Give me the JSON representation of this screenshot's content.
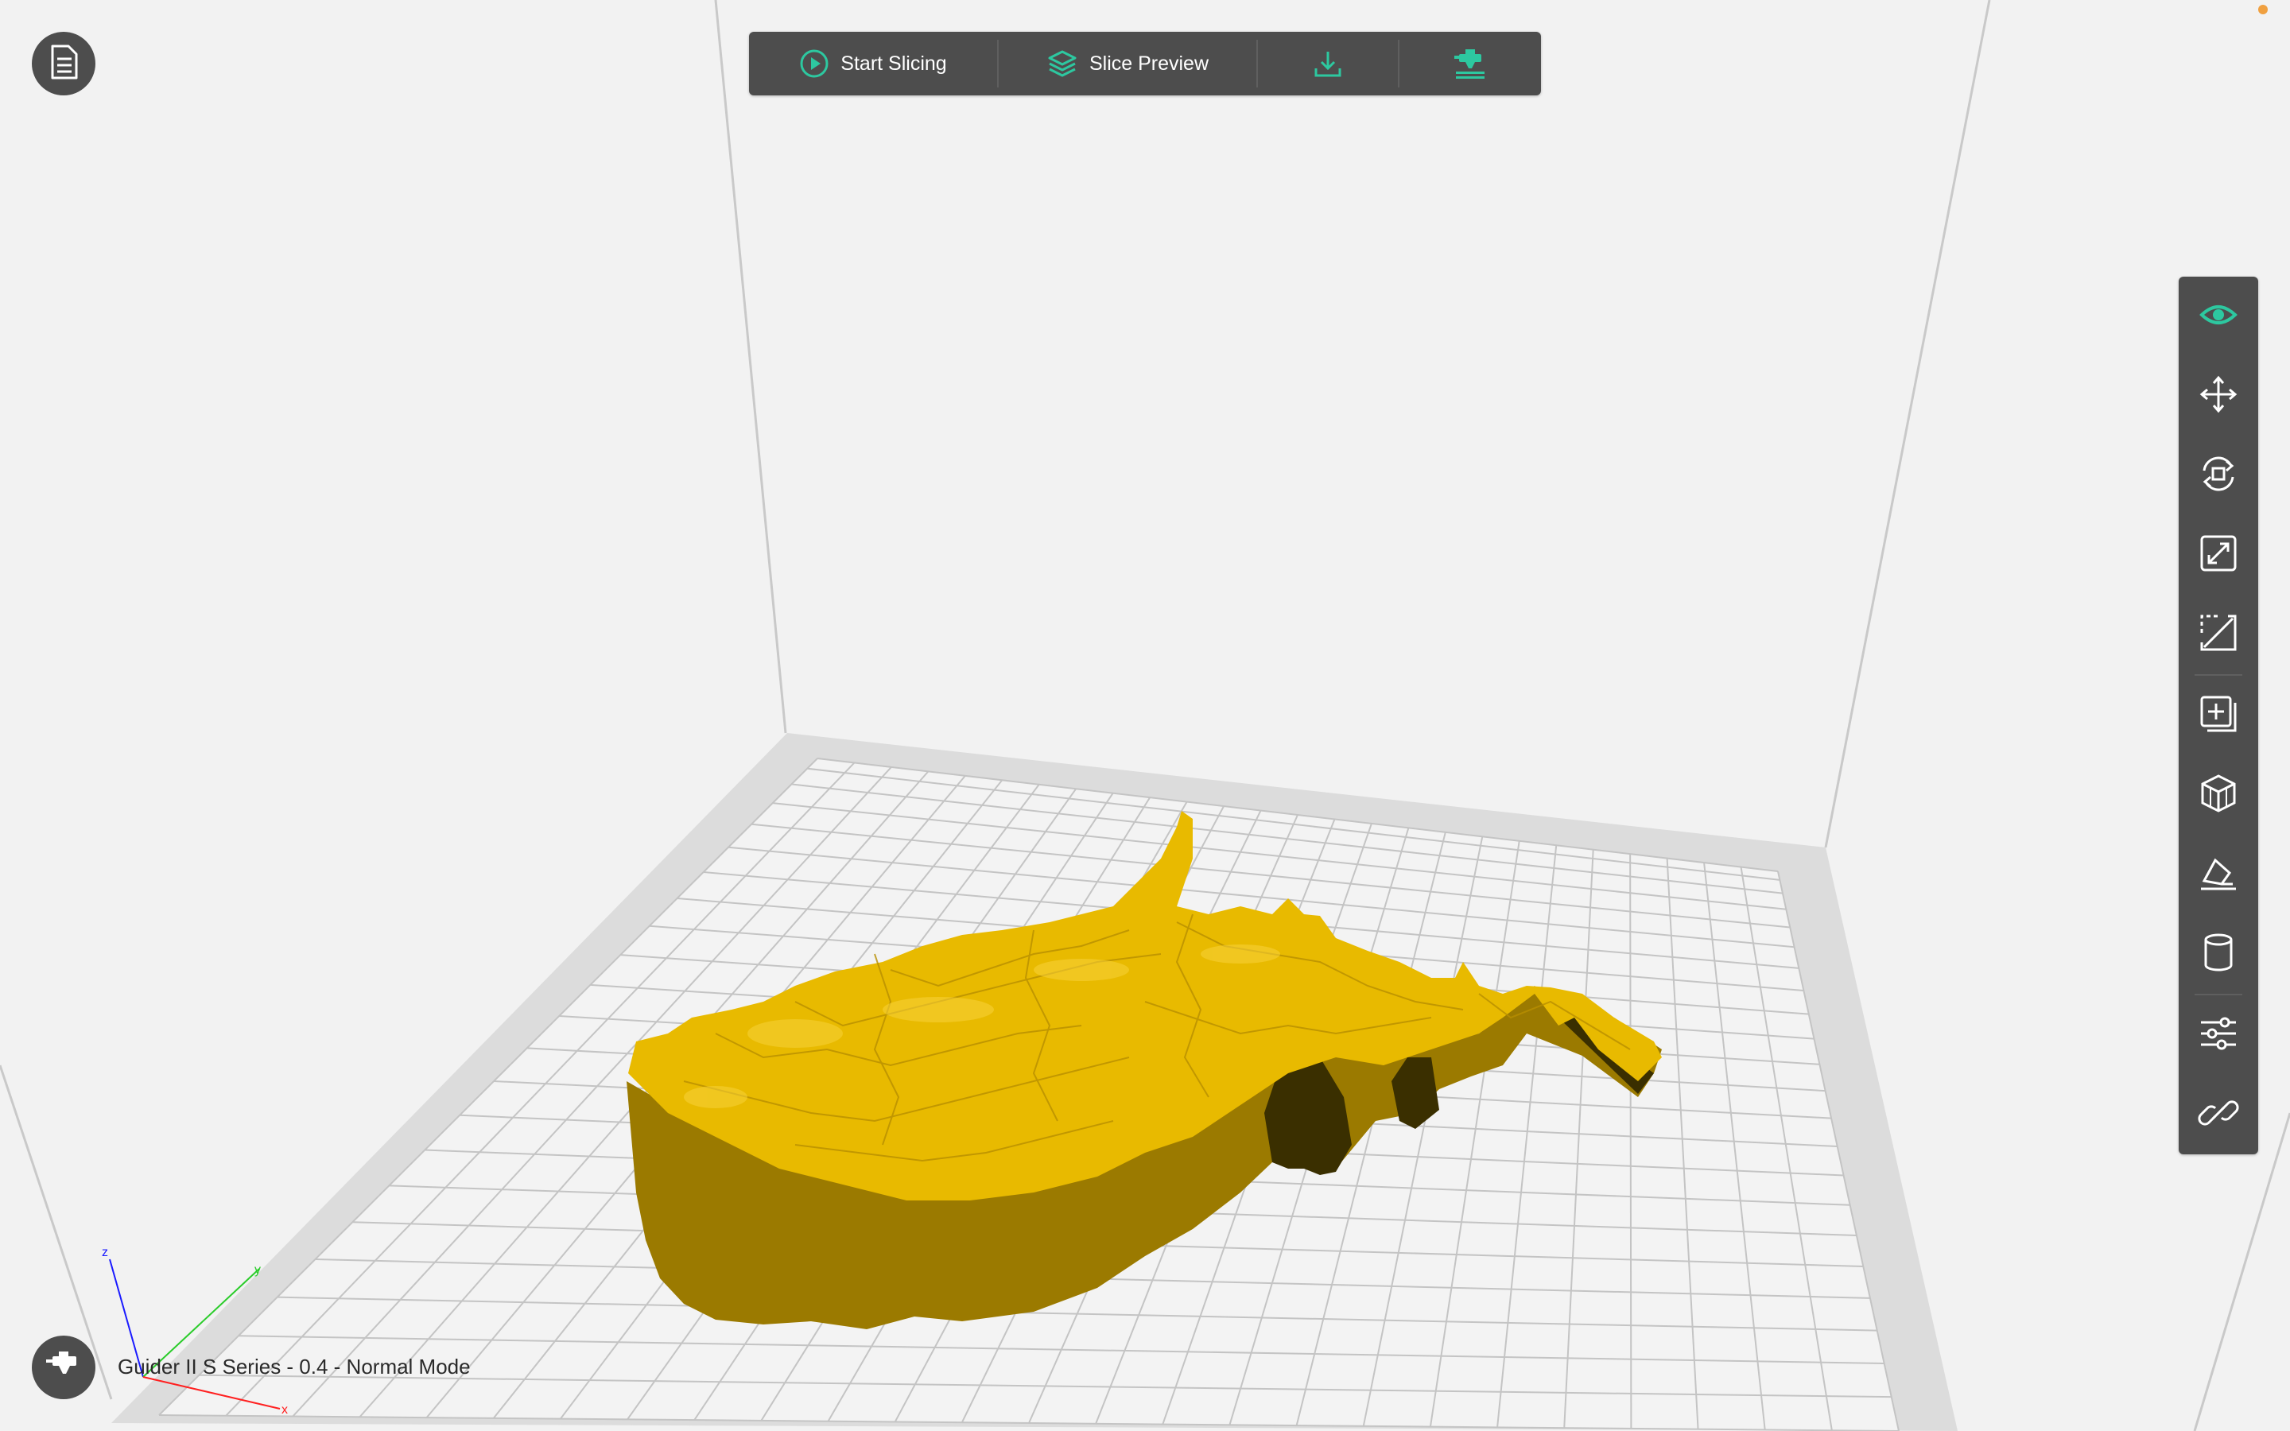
{
  "toolbar": {
    "start_slicing_label": "Start Slicing",
    "slice_preview_label": "Slice Preview",
    "icons": {
      "start_slicing": "play-circle-icon",
      "slice_preview": "layers-icon",
      "export": "download-icon",
      "print": "print-nozzle-icon"
    }
  },
  "file_button": {
    "icon": "file-document-icon"
  },
  "printer": {
    "icon": "printer-nozzle-icon",
    "label": "Guider II S Series - 0.4 - Normal Mode"
  },
  "axes": {
    "x": "x",
    "y": "y",
    "z": "z"
  },
  "right_toolbar": {
    "items": [
      {
        "name": "view",
        "icon": "eye-icon",
        "active": true
      },
      {
        "name": "move",
        "icon": "move-arrows-icon"
      },
      {
        "name": "rotate",
        "icon": "rotate-icon"
      },
      {
        "name": "scale",
        "icon": "scale-icon"
      },
      {
        "name": "cut",
        "icon": "cut-icon"
      },
      {
        "name": "add-copy",
        "icon": "add-copy-icon"
      },
      {
        "name": "arrange",
        "icon": "arrange-cubes-icon"
      },
      {
        "name": "lay-on-face",
        "icon": "lay-flat-icon"
      },
      {
        "name": "support",
        "icon": "cylinder-icon"
      },
      {
        "name": "settings",
        "icon": "sliders-icon"
      },
      {
        "name": "link",
        "icon": "link-icon"
      }
    ]
  },
  "colors": {
    "accent": "#2dc8a0",
    "toolbar_bg": "#4d4d4d",
    "model": "#e0b400",
    "background": "#f2f2f2",
    "status_dot": "#f0a040"
  }
}
